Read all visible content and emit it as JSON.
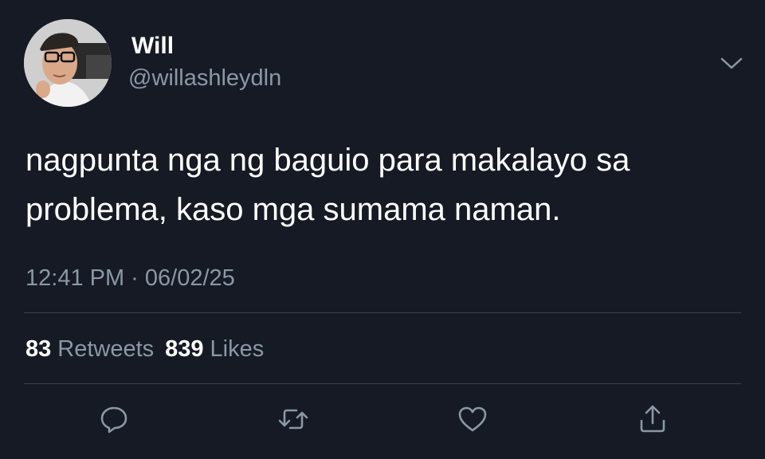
{
  "author": {
    "name": "Will",
    "handle": "@willashleydln",
    "avatar_icon": "profile-photo"
  },
  "tweet": {
    "text": "nagpunta nga ng baguio para makalayo sa problema, kaso mga sumama naman.",
    "timestamp": "12:41 PM · 06/02/25"
  },
  "stats": {
    "retweets_count": "83",
    "retweets_label": "Retweets",
    "likes_count": "839",
    "likes_label": "Likes"
  },
  "actions": [
    {
      "icon": "reply-icon"
    },
    {
      "icon": "retweet-icon"
    },
    {
      "icon": "like-icon"
    },
    {
      "icon": "share-icon"
    }
  ],
  "colors": {
    "background": "#151a24",
    "primary_text": "#ffffff",
    "secondary_text": "#8b98a5",
    "divider": "#38444d"
  }
}
